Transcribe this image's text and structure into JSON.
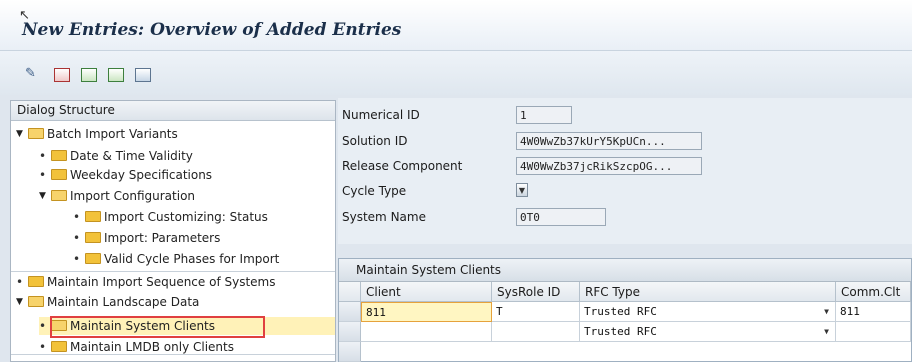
{
  "window": {
    "title": "New Entries: Overview of Added Entries"
  },
  "toolbar": {
    "buttons": [
      {
        "icon": "display-change-icon"
      },
      {
        "icon": "delete-row-icon"
      },
      {
        "icon": "select-all-icon"
      },
      {
        "icon": "select-block-icon"
      },
      {
        "icon": "deselect-all-icon"
      }
    ]
  },
  "tree": {
    "header": "Dialog Structure",
    "nodes": [
      {
        "label": "Batch Import Variants",
        "expanded": true
      },
      {
        "label": "Date & Time Validity"
      },
      {
        "label": "Weekday Specifications"
      },
      {
        "label": "Import Configuration",
        "expanded": true
      },
      {
        "label": "Import Customizing: Status"
      },
      {
        "label": "Import: Parameters"
      },
      {
        "label": "Valid Cycle Phases for Import"
      },
      {
        "label": "Maintain Import Sequence of Systems"
      },
      {
        "label": "Maintain Landscape Data",
        "expanded": true
      },
      {
        "label": "Maintain System Clients",
        "selected": true
      },
      {
        "label": "Maintain LMDB only Clients"
      }
    ]
  },
  "form": {
    "numerical_id": {
      "label": "Numerical ID",
      "value": "1"
    },
    "solution_id": {
      "label": "Solution ID",
      "value": "4W0WwZb37kUrY5KpUCn..."
    },
    "release_component": {
      "label": "Release Component",
      "value": "4W0WwZb37jcRikSzcpOG..."
    },
    "cycle_type": {
      "label": "Cycle Type",
      "value": ""
    },
    "system_name": {
      "label": "System Name",
      "value": "0T0"
    }
  },
  "grid": {
    "title": "Maintain System Clients",
    "columns": [
      "Client",
      "SysRole ID",
      "RFC Type",
      "Comm.Clt"
    ],
    "rows": [
      {
        "client": "811",
        "sysrole": "T",
        "rfc_type": "Trusted RFC",
        "comm_clt": "811"
      },
      {
        "client": "",
        "sysrole": "",
        "rfc_type": "Trusted RFC",
        "comm_clt": ""
      }
    ]
  },
  "colors": {
    "selection_highlight": "#e04040",
    "active_cell": "#fff6c2"
  }
}
